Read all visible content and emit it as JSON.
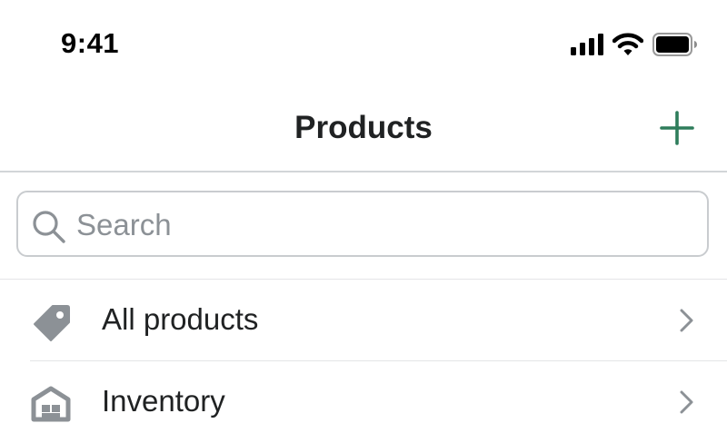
{
  "status_bar": {
    "time": "9:41",
    "icons": [
      "cellular-signal-icon",
      "wifi-icon",
      "battery-icon"
    ]
  },
  "nav": {
    "title": "Products",
    "add_icon": "plus-icon"
  },
  "search": {
    "placeholder": "Search",
    "value": "",
    "icon": "search-icon"
  },
  "menu": {
    "items": [
      {
        "label": "All products",
        "icon": "tag-icon"
      },
      {
        "label": "Inventory",
        "icon": "warehouse-icon"
      }
    ]
  },
  "colors": {
    "accent": "#2e7d5b",
    "icon_gray": "#8c9196",
    "divider": "#d2d5d8",
    "text": "#202223"
  }
}
